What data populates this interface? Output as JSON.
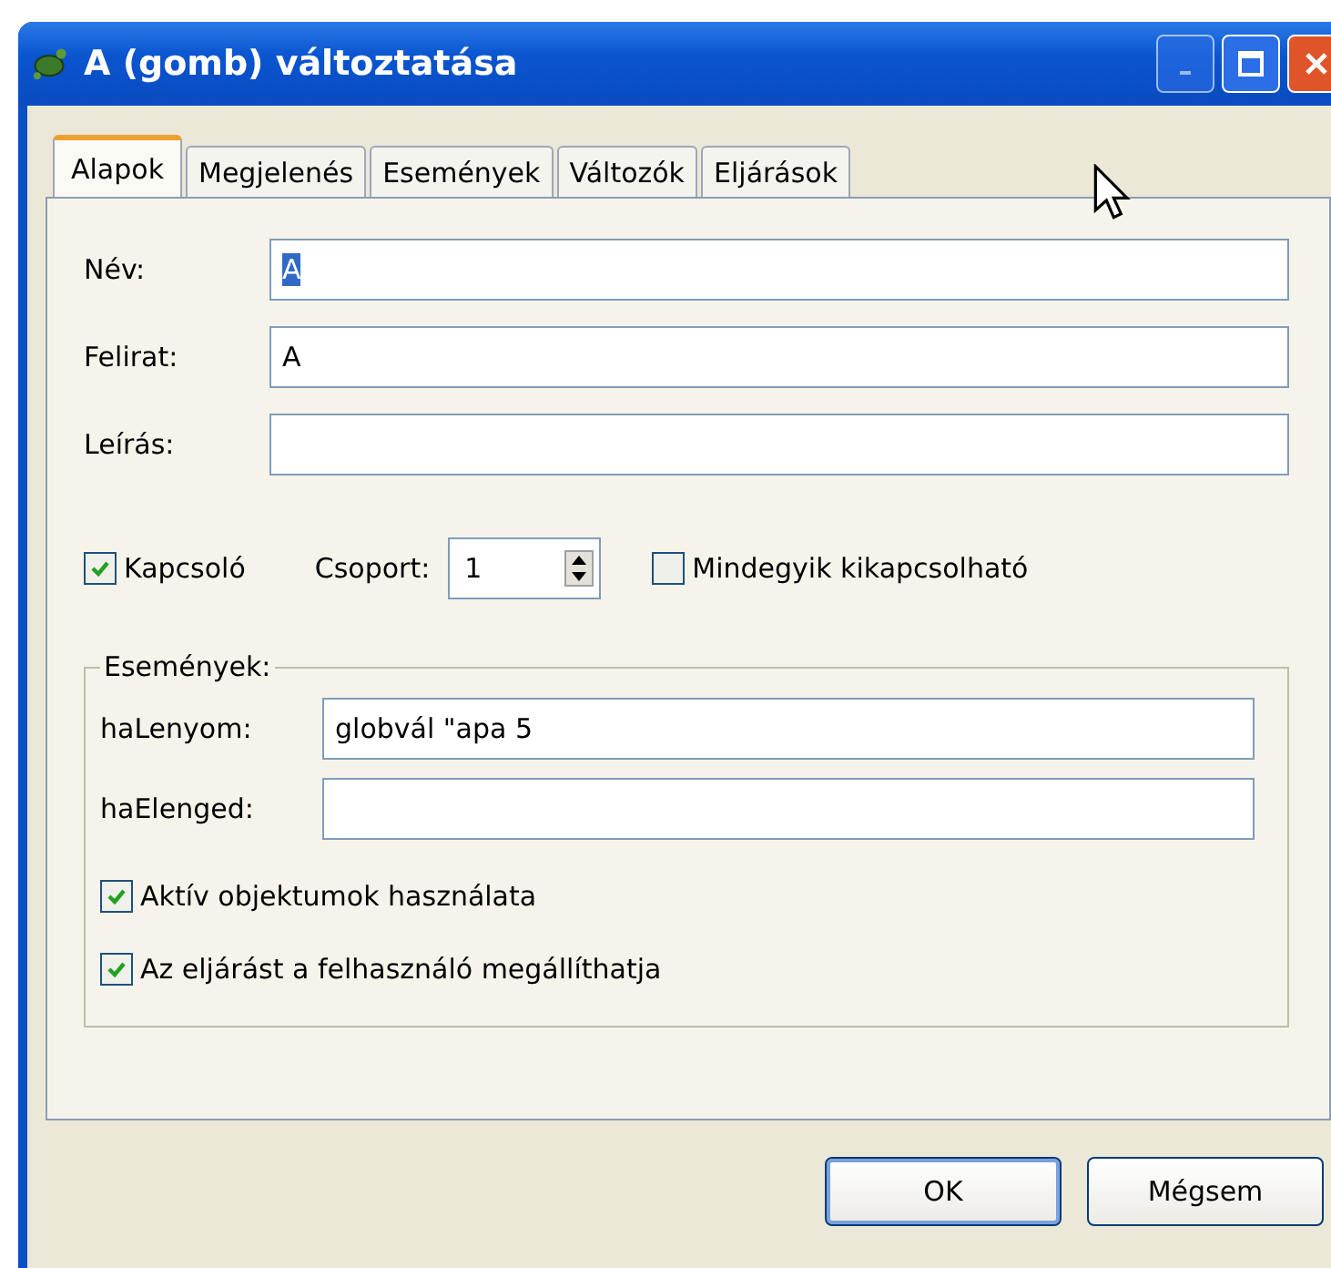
{
  "window": {
    "title": "A (gomb) változtatása"
  },
  "tabs": [
    {
      "label": "Alapok",
      "selected": true
    },
    {
      "label": "Megjelenés",
      "selected": false
    },
    {
      "label": "Események",
      "selected": false
    },
    {
      "label": "Változók",
      "selected": false
    },
    {
      "label": "Eljárások",
      "selected": false
    }
  ],
  "fields": [
    {
      "label": "Név:",
      "value": "A",
      "text_selected": true
    },
    {
      "label": "Felirat:",
      "value": "A",
      "text_selected": false
    },
    {
      "label": "Leírás:"
    }
  ],
  "switch": {
    "label": "Kapcsoló",
    "checked": true
  },
  "group_spinner": {
    "label": "Csoport:",
    "value": "1"
  },
  "all_off": {
    "label": "Mindegyik kikapcsolható",
    "checked": false
  },
  "events": {
    "title": "Események:",
    "fields": [
      {
        "label": "haLenyom:",
        "value": "globvál \"apa 5"
      },
      {
        "label": "haElenged:"
      }
    ],
    "options": [
      {
        "label": "Aktív objektumok használata",
        "checked": true
      },
      {
        "label": "Az eljárást a felhasználó megállíthatja",
        "checked": true
      }
    ]
  },
  "buttons": [
    {
      "label": "OK",
      "default": true
    },
    {
      "label": "Mégsem",
      "default": false
    }
  ]
}
